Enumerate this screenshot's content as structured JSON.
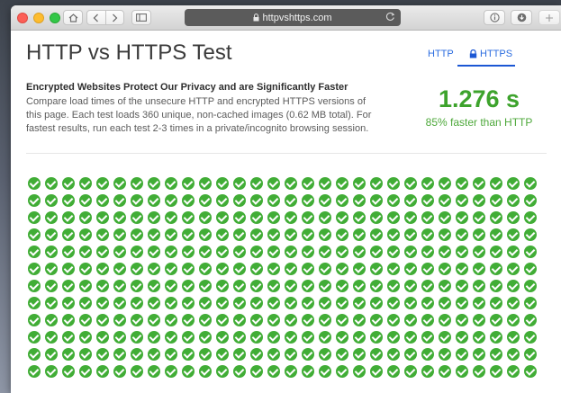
{
  "browser": {
    "url": "httpvshttps.com"
  },
  "page": {
    "title": "HTTP vs HTTPS Test",
    "tabs": {
      "http": "HTTP",
      "https": "HTTPS"
    },
    "subheading": "Encrypted Websites Protect Our Privacy and are Significantly Faster",
    "description": "Compare load times of the unsecure HTTP and encrypted HTTPS versions of this page. Each test loads 360 unique, non-cached images (0.62 MB total). For fastest results, run each test 2-3 times in a private/incognito browsing session.",
    "result_time": "1.276 s",
    "result_note": "85% faster than HTTP"
  },
  "image_grid": {
    "loaded_count": 360,
    "columns": 30,
    "rows": 12,
    "status_icon": "check-circle-icon"
  },
  "colors": {
    "accent_blue": "#2d6ee0",
    "success_green": "#3da32c",
    "check_green": "#41ad36"
  }
}
